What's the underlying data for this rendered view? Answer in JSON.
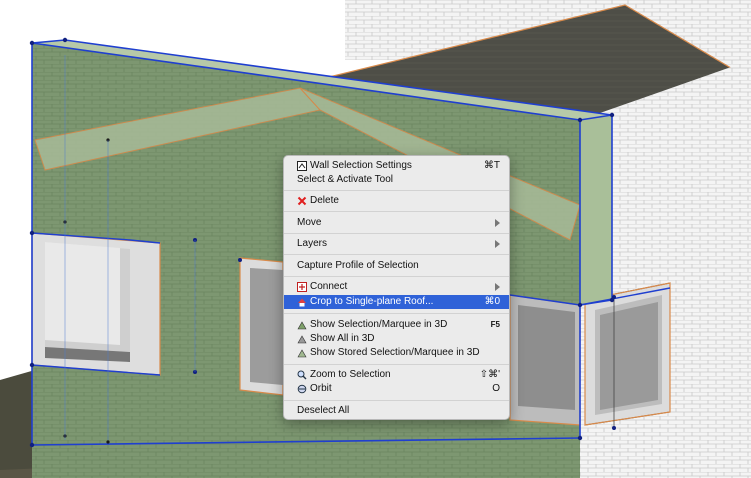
{
  "menu": {
    "wall_selection_settings": {
      "label": "Wall Selection Settings",
      "shortcut": "⌘T",
      "icon": "wall-settings-icon"
    },
    "select_activate_tool": {
      "label": "Select & Activate Tool"
    },
    "delete": {
      "label": "Delete",
      "icon": "red-x-icon"
    },
    "move": {
      "label": "Move"
    },
    "layers": {
      "label": "Layers"
    },
    "capture_profile": {
      "label": "Capture Profile of Selection"
    },
    "connect": {
      "label": "Connect",
      "icon": "connect-icon"
    },
    "crop_roof": {
      "label": "Crop to Single-plane Roof...",
      "shortcut": "⌘0",
      "icon": "crop-roof-icon"
    },
    "show_selection_3d": {
      "label": "Show Selection/Marquee in 3D",
      "shortcut": "F5",
      "icon": "show-selection-3d-icon"
    },
    "show_all_3d": {
      "label": "Show All in 3D",
      "icon": "show-all-3d-icon"
    },
    "show_stored_3d": {
      "label": "Show Stored Selection/Marquee in 3D",
      "icon": "show-stored-3d-icon"
    },
    "zoom_selection": {
      "label": "Zoom to Selection",
      "shortcut": "⇧⌘'",
      "icon": "zoom-icon"
    },
    "orbit": {
      "label": "Orbit",
      "shortcut": "O",
      "icon": "orbit-icon"
    },
    "deselect_all": {
      "label": "Deselect All"
    }
  },
  "colors": {
    "highlight": "#2f62d8",
    "selection_edge": "#1f3fd0",
    "wall_green": "#7e9a72",
    "roof_dark": "#4b4b44"
  }
}
